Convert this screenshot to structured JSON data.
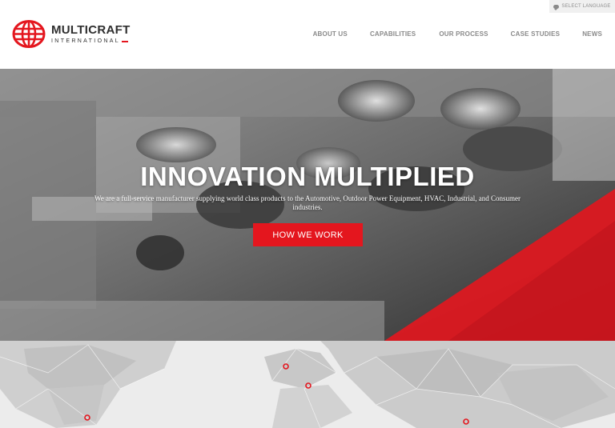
{
  "header": {
    "language_button": {
      "icon": "chat-bubble-icon",
      "label": "SELECT LANGUAGE"
    },
    "logo": {
      "brand": "MULTICRAFT",
      "sub": "INTERNATIONAL",
      "icon": "globe-icon",
      "color": "#e4161e"
    },
    "nav": [
      {
        "label": "ABOUT US"
      },
      {
        "label": "CAPABILITIES"
      },
      {
        "label": "OUR PROCESS"
      },
      {
        "label": "CASE STUDIES"
      },
      {
        "label": "NEWS"
      }
    ]
  },
  "hero": {
    "title": "INNOVATION MULTIPLIED",
    "subtitle": "We are a full-service manufacturer supplying world class products to the Automotive, Outdoor Power Equipment, HVAC, Industrial, and Consumer industries.",
    "cta_label": "HOW WE WORK",
    "accent_color": "#e4161e"
  },
  "map": {
    "background_color": "#ececec",
    "marker_color": "#e4161e"
  }
}
